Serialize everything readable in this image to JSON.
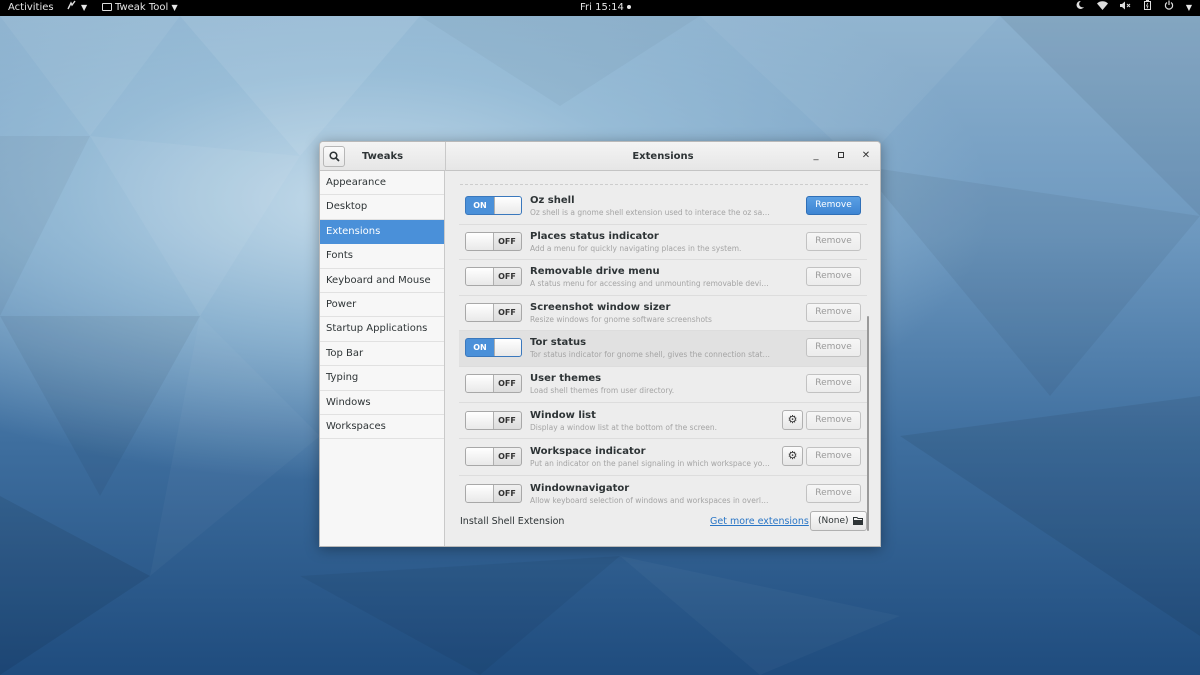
{
  "topbar": {
    "activities": "Activities",
    "app_name": "Tweak Tool",
    "clock": "Fri 15:14",
    "tray_icons": [
      "night-light-icon",
      "wifi-icon",
      "volume-muted-icon",
      "battery-icon",
      "power-icon"
    ]
  },
  "window": {
    "left_title": "Tweaks",
    "main_title": "Extensions"
  },
  "sidebar": {
    "items": [
      {
        "label": "Appearance"
      },
      {
        "label": "Desktop"
      },
      {
        "label": "Extensions",
        "active": true
      },
      {
        "label": "Fonts"
      },
      {
        "label": "Keyboard and Mouse"
      },
      {
        "label": "Power"
      },
      {
        "label": "Startup Applications"
      },
      {
        "label": "Top Bar"
      },
      {
        "label": "Typing"
      },
      {
        "label": "Windows"
      },
      {
        "label": "Workspaces"
      }
    ]
  },
  "switch_labels": {
    "on": "ON",
    "off": "OFF"
  },
  "remove_label": "Remove",
  "extensions": [
    {
      "name": "Oz shell",
      "desc": "Oz shell is a gnome shell extension used to interace the oz sandboxing dae…",
      "enabled": true,
      "remove_active": true
    },
    {
      "name": "Places status indicator",
      "desc": "Add a menu for quickly navigating places in the system.",
      "enabled": false
    },
    {
      "name": "Removable drive menu",
      "desc": "A status menu for accessing and unmounting removable devices.",
      "enabled": false
    },
    {
      "name": "Screenshot window sizer",
      "desc": "Resize windows for gnome software screenshots",
      "enabled": false
    },
    {
      "name": "Tor status",
      "desc": "Tor status indicator for gnome shell, gives the connection status, allow new i…",
      "enabled": true,
      "highlighted": true
    },
    {
      "name": "User themes",
      "desc": "Load shell themes from user directory.",
      "enabled": false
    },
    {
      "name": "Window list",
      "desc": "Display a window list at the bottom of the screen.",
      "enabled": false,
      "settings": true
    },
    {
      "name": "Workspace indicator",
      "desc": "Put an indicator on the panel signaling in which workspace you are, a…",
      "enabled": false,
      "settings": true
    },
    {
      "name": "Windownavigator",
      "desc": "Allow keyboard selection of windows and workspaces in overlay mode. <ctrl>…",
      "enabled": false
    }
  ],
  "footer": {
    "install_label": "Install Shell Extension",
    "link": "Get more extensions",
    "file_button": "(None)"
  },
  "colors": {
    "accent": "#4a90d9",
    "link": "#2a76c6"
  }
}
